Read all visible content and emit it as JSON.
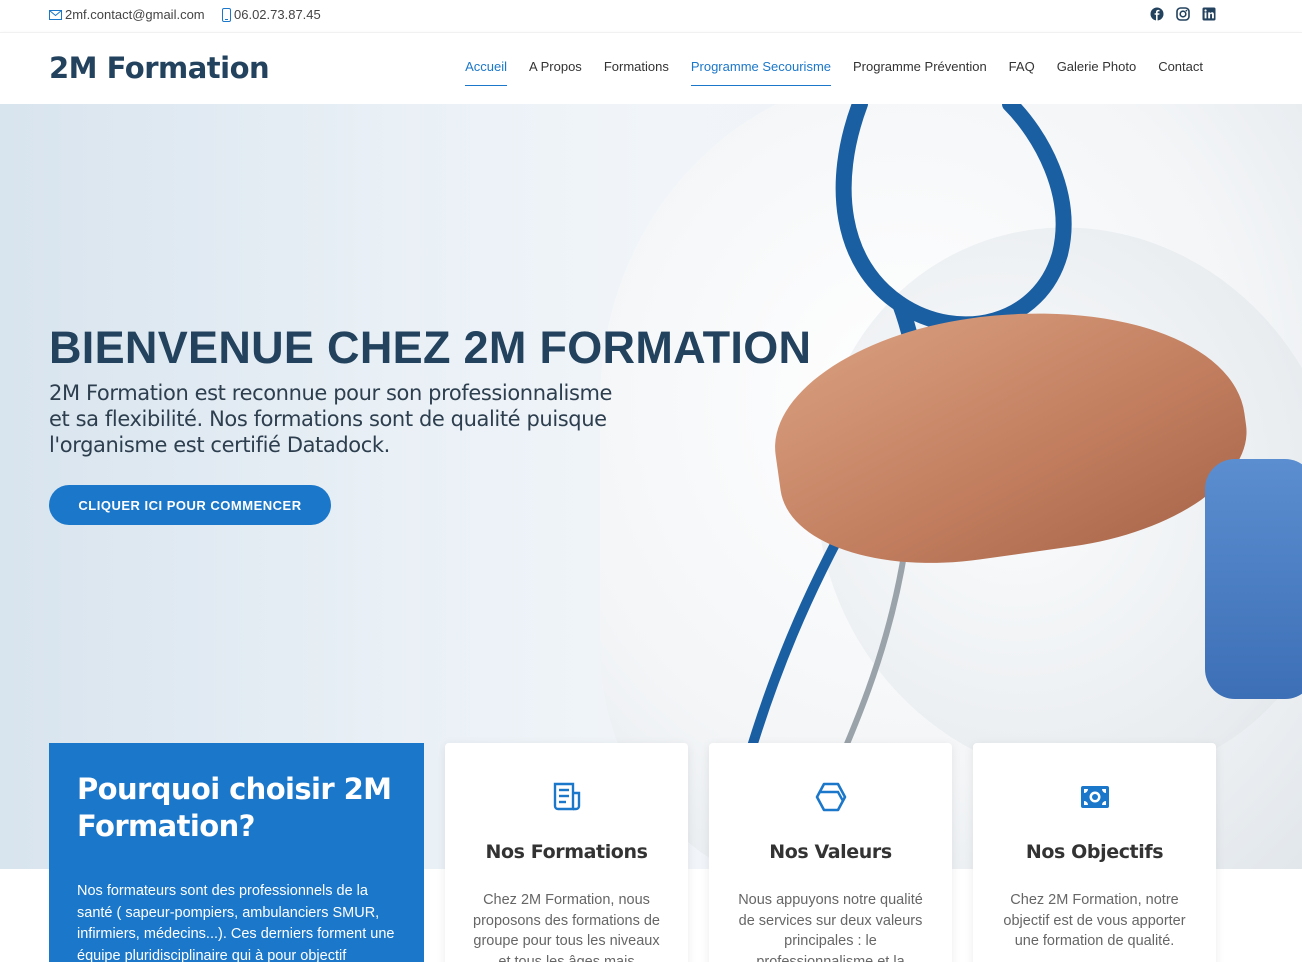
{
  "topbar": {
    "email": "2mf.contact@gmail.com",
    "phone": "06.02.73.87.45",
    "social": [
      "facebook-icon",
      "instagram-icon",
      "linkedin-icon"
    ]
  },
  "header": {
    "logo": "2M Formation",
    "nav": [
      "Accueil",
      "A Propos",
      "Formations",
      "Programme Secourisme",
      "Programme Prévention",
      "FAQ",
      "Galerie Photo",
      "Contact"
    ]
  },
  "hero": {
    "title": "BIENVENUE CHEZ 2M FORMATION",
    "text": "2M Formation est reconnue pour son professionnalisme et sa flexibilité. Nos formations sont de qualité puisque l'organisme est certifié Datadock.",
    "cta": "CLIQUER ICI POUR COMMENCER"
  },
  "why": {
    "title": "Pourquoi choisir 2M Formation?",
    "text": "Nos formateurs sont des professionnels de la santé ( sapeur-pompiers, ambulanciers SMUR, infirmiers, médecins...). Ces derniers forment une équipe pluridisciplinaire qui à pour objectif"
  },
  "cards": [
    {
      "title": "Nos Formations",
      "text": "Chez 2M Formation, nous proposons des formations de groupe pour tous les niveaux et tous les âges mais",
      "icon": "document-icon"
    },
    {
      "title": "Nos Valeurs",
      "text": "Nous appuyons notre qualité de services sur deux valeurs principales : le professionnalisme et la",
      "icon": "hexagon-icon"
    },
    {
      "title": "Nos Objectifs",
      "text": "Chez 2M Formation, notre objectif est de vous apporter une formation de qualité.",
      "icon": "money-icon"
    }
  ],
  "colors": {
    "accent": "#1b77c9",
    "heading": "#23425e"
  }
}
